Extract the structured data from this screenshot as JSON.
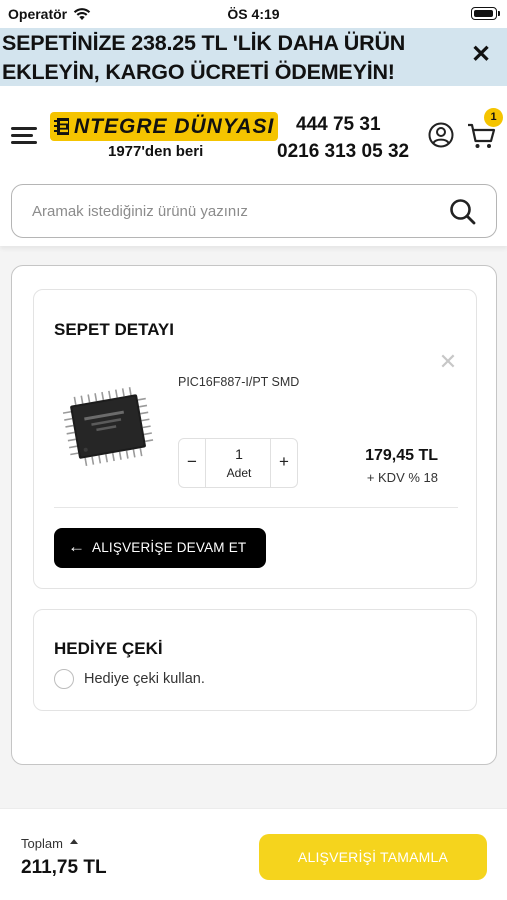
{
  "status_bar": {
    "carrier": "Operatör",
    "time": "ÖS 4:19"
  },
  "promo": {
    "text": "SEPETİNİZE 238.25 TL 'LİK DAHA ÜRÜN EKLEYİN, KARGO ÜCRETİ ÖDEMEYİN!",
    "close_icon": "close-icon"
  },
  "header": {
    "logo_text": "NTEGRE DÜNYASI",
    "logo_subtitle": "1977'den beri",
    "phone_1": "444 75 31",
    "phone_2": "0216 313 05 32",
    "cart_count": "1",
    "icons": [
      "menu-icon",
      "user-icon",
      "cart-icon"
    ]
  },
  "search": {
    "placeholder": "Aramak istediğiniz ürünü yazınız",
    "icon": "search-icon"
  },
  "cart": {
    "title": "SEPET DETAYI",
    "items": [
      {
        "name": "PIC16F887-I/PT SMD",
        "quantity": "1",
        "unit": "Adet",
        "minus": "−",
        "plus": "+",
        "price": "179,45 TL",
        "tax": "+ KDV % 18",
        "remove": "✕"
      }
    ],
    "continue_label": "ALIŞVERİŞE DEVAM ET",
    "continue_arrow": "←"
  },
  "gift": {
    "title": "HEDİYE ÇEKİ",
    "option_label": "Hediye çeki kullan."
  },
  "footer": {
    "total_label": "Toplam",
    "total_value": "211,75 TL",
    "checkout_label": "ALIŞVERİŞİ TAMAMLA"
  },
  "colors": {
    "brand_yellow": "#f5c400",
    "checkout_yellow": "#f5d41d",
    "promo_bg": "#d3e4ee",
    "button_black": "#000000"
  }
}
